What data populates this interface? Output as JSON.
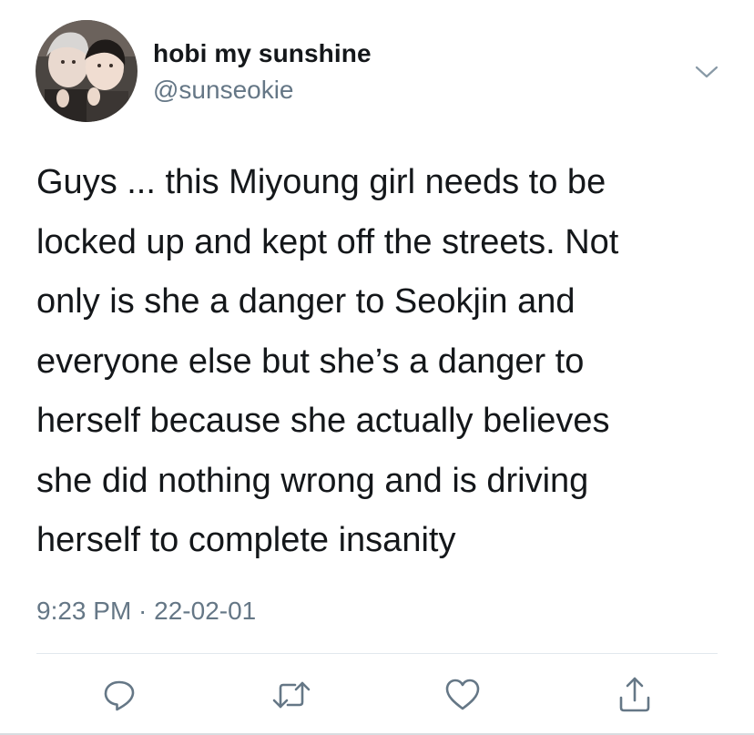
{
  "tweet": {
    "display_name": "hobi my sunshine",
    "handle": "@sunseokie",
    "avatar_icon": "profile-photo",
    "menu_icon": "chevron-down-icon",
    "text_lines": [
      "Guys ... this Miyoung girl needs to be",
      "locked up and kept off the streets. Not",
      "only is she a danger to Seokjin and",
      "everyone else but she’s a danger to",
      "herself because she actually believes",
      "she did nothing wrong and is driving",
      "herself to complete insanity"
    ],
    "timestamp": "9:23 PM · 22-02-01"
  },
  "actions": {
    "reply_icon": "reply-icon",
    "retweet_icon": "retweet-icon",
    "like_icon": "heart-icon",
    "share_icon": "share-icon"
  },
  "colors": {
    "text": "#14171a",
    "secondary": "#657786",
    "icon": "#657786",
    "divider": "#e1e8ed"
  }
}
